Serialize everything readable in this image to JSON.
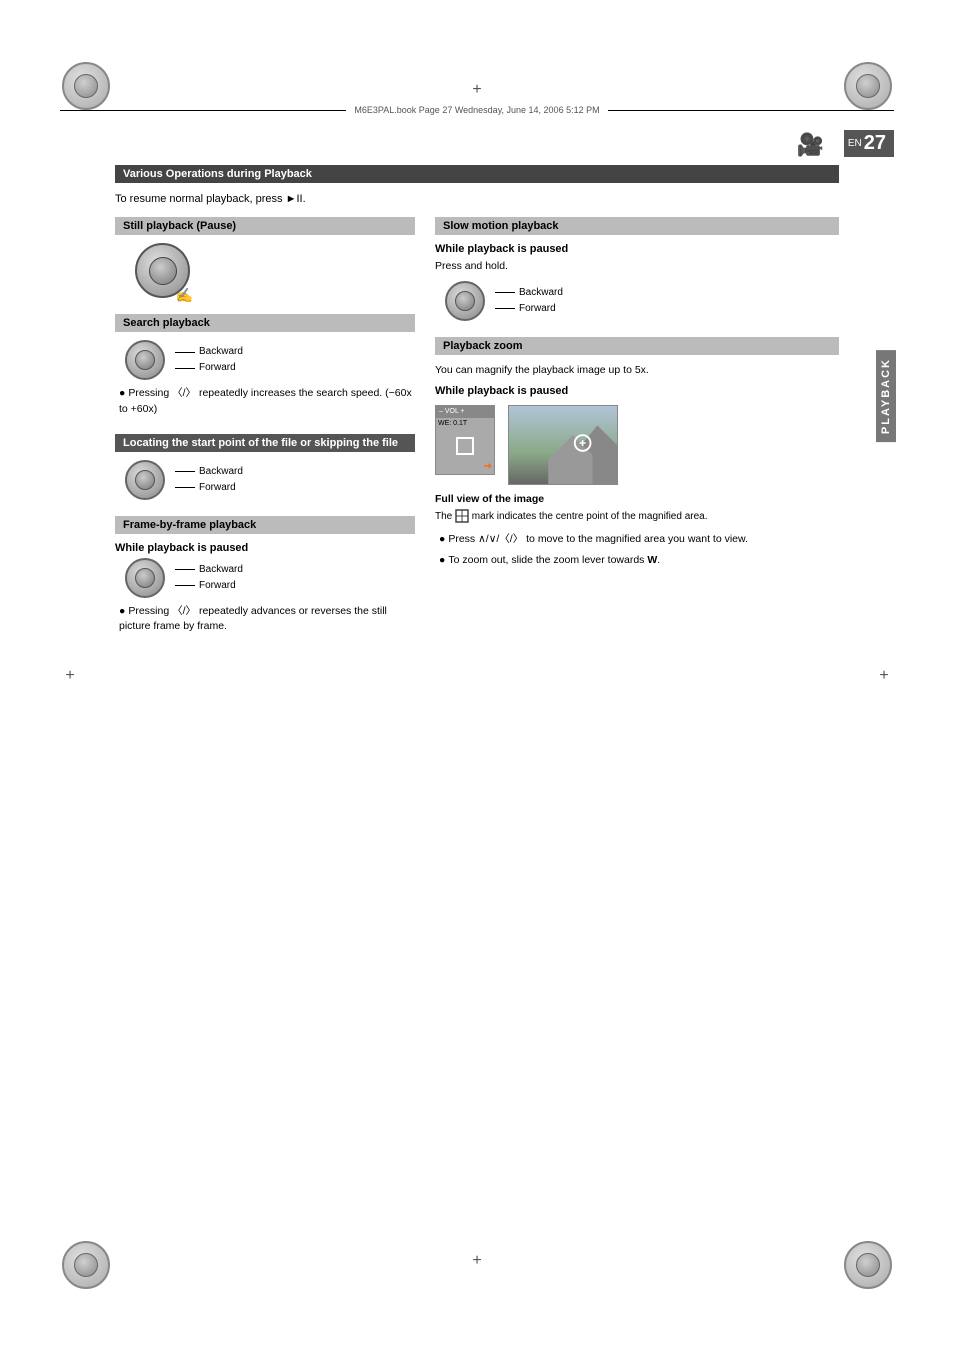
{
  "page": {
    "number": "27",
    "lang": "EN",
    "section_label": "PLAYBACK",
    "file_info": "M6E3PAL.book  Page 27  Wednesday, June 14, 2006  5:12 PM"
  },
  "main_title": "Various Operations during Playback",
  "intro": "To resume normal playback, press ►II.",
  "sections": {
    "still_playback": {
      "title": "Still playback (Pause)"
    },
    "search_playback": {
      "title": "Search playback",
      "backward_label": "Backward",
      "forward_label": "Forward",
      "bullet": "Pressing 〈/〉 repeatedly increases the search speed. (−60x to +60x)"
    },
    "locating": {
      "title": "Locating the start point of the file or skipping the file",
      "backward_label": "Backward",
      "forward_label": "Forward"
    },
    "frame_by_frame": {
      "title": "Frame-by-frame playback",
      "while_paused": "While playback is paused",
      "backward_label": "Backward",
      "forward_label": "Forward",
      "bullet": "Pressing 〈/〉 repeatedly advances or reverses the still picture frame by frame."
    },
    "slow_motion": {
      "title": "Slow motion playback",
      "while_paused": "While playback is paused",
      "press_hold": "Press and hold.",
      "backward_label": "Backward",
      "forward_label": "Forward"
    },
    "playback_zoom": {
      "title": "Playback zoom",
      "intro": "You can magnify the playback image up to 5x.",
      "while_paused": "While playback is paused",
      "full_view_title": "Full view of the image",
      "full_view_text": "The   mark indicates the centre point of the magnified area.",
      "bullet1": "Press ∧/∨/〈/〉 to move to the magnified area you want to view.",
      "bullet2": "To zoom out, slide the zoom lever towards W.",
      "zoom_display_text": "– VOL +",
      "we_label": "WE: 0.1T"
    }
  }
}
